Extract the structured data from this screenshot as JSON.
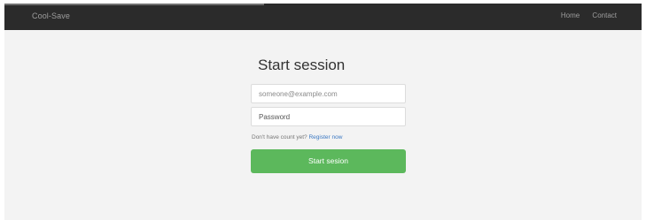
{
  "navbar": {
    "brand": "Cool-Save",
    "links": [
      "Home",
      "Contact"
    ]
  },
  "login": {
    "title": "Start session",
    "email_value": "someone@example.com",
    "password_value": "Password",
    "hint_text": "Don't have count yet?",
    "register_link": "Register now",
    "submit_label": "Start sesion"
  }
}
